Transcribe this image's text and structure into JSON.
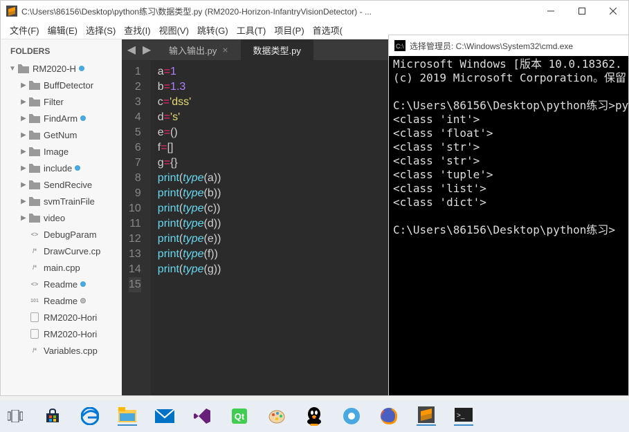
{
  "sublime": {
    "title": "C:\\Users\\86156\\Desktop\\python练习\\数据类型.py (RM2020-Horizon-InfantryVisionDetector) - ...",
    "menu": [
      "文件(F)",
      "编辑(E)",
      "选择(S)",
      "查找(I)",
      "视图(V)",
      "跳转(G)",
      "工具(T)",
      "项目(P)",
      "首选项("
    ],
    "sidebar_header": "FOLDERS",
    "tree": [
      {
        "depth": 0,
        "type": "folder-open",
        "name": "RM2020-H",
        "dot": "b",
        "arrow": "▼"
      },
      {
        "depth": 1,
        "type": "folder",
        "name": "BuffDetector",
        "arrow": "▶"
      },
      {
        "depth": 1,
        "type": "folder",
        "name": "Filter",
        "arrow": "▶"
      },
      {
        "depth": 1,
        "type": "folder",
        "name": "FindArm",
        "dot": "b",
        "arrow": "▶"
      },
      {
        "depth": 1,
        "type": "folder",
        "name": "GetNum",
        "arrow": "▶"
      },
      {
        "depth": 1,
        "type": "folder",
        "name": "Image",
        "arrow": "▶"
      },
      {
        "depth": 1,
        "type": "folder",
        "name": "include",
        "dot": "b",
        "arrow": "▶"
      },
      {
        "depth": 1,
        "type": "folder",
        "name": "SendRecive",
        "arrow": "▶"
      },
      {
        "depth": 1,
        "type": "folder",
        "name": "svmTrainFile",
        "arrow": "▶"
      },
      {
        "depth": 1,
        "type": "folder",
        "name": "video",
        "arrow": "▶"
      },
      {
        "depth": 1,
        "type": "code",
        "name": "DebugParam",
        "arrow": ""
      },
      {
        "depth": 1,
        "type": "cpp",
        "name": "DrawCurve.cp",
        "arrow": ""
      },
      {
        "depth": 1,
        "type": "cpp",
        "name": "main.cpp",
        "arrow": ""
      },
      {
        "depth": 1,
        "type": "code",
        "name": "Readme",
        "dot": "b",
        "arrow": ""
      },
      {
        "depth": 1,
        "type": "md",
        "name": "Readme",
        "dot": "g",
        "arrow": ""
      },
      {
        "depth": 1,
        "type": "file",
        "name": "RM2020-Hori",
        "arrow": ""
      },
      {
        "depth": 1,
        "type": "file",
        "name": "RM2020-Hori",
        "arrow": ""
      },
      {
        "depth": 1,
        "type": "cpp",
        "name": "Variables.cpp",
        "arrow": ""
      }
    ],
    "tabs": {
      "inactive": "输入输出.py",
      "active": "数据类型.py"
    },
    "code": [
      [
        [
          "var",
          "a"
        ],
        [
          "op",
          "="
        ],
        [
          "num",
          "1"
        ]
      ],
      [
        [
          "var",
          "b"
        ],
        [
          "op",
          "="
        ],
        [
          "num",
          "1.3"
        ]
      ],
      [
        [
          "var",
          "c"
        ],
        [
          "op",
          "="
        ],
        [
          "str",
          "'dss'"
        ]
      ],
      [
        [
          "var",
          "d"
        ],
        [
          "op",
          "="
        ],
        [
          "str",
          "'s'"
        ]
      ],
      [
        [
          "var",
          "e"
        ],
        [
          "op",
          "="
        ],
        [
          "pn",
          "()"
        ]
      ],
      [
        [
          "var",
          "f"
        ],
        [
          "op",
          "="
        ],
        [
          "pn",
          "[]"
        ]
      ],
      [
        [
          "var",
          "g"
        ],
        [
          "op",
          "="
        ],
        [
          "pn",
          "{}"
        ]
      ],
      [
        [
          "fn",
          "print"
        ],
        [
          "pn",
          "("
        ],
        [
          "bi",
          "type"
        ],
        [
          "pn",
          "("
        ],
        [
          "var",
          "a"
        ],
        [
          "pn",
          "))"
        ]
      ],
      [
        [
          "fn",
          "print"
        ],
        [
          "pn",
          "("
        ],
        [
          "bi",
          "type"
        ],
        [
          "pn",
          "("
        ],
        [
          "var",
          "b"
        ],
        [
          "pn",
          "))"
        ]
      ],
      [
        [
          "fn",
          "print"
        ],
        [
          "pn",
          "("
        ],
        [
          "bi",
          "type"
        ],
        [
          "pn",
          "("
        ],
        [
          "var",
          "c"
        ],
        [
          "pn",
          "))"
        ]
      ],
      [
        [
          "fn",
          "print"
        ],
        [
          "pn",
          "("
        ],
        [
          "bi",
          "type"
        ],
        [
          "pn",
          "("
        ],
        [
          "var",
          "d"
        ],
        [
          "pn",
          "))"
        ]
      ],
      [
        [
          "fn",
          "print"
        ],
        [
          "pn",
          "("
        ],
        [
          "bi",
          "type"
        ],
        [
          "pn",
          "("
        ],
        [
          "var",
          "e"
        ],
        [
          "pn",
          "))"
        ]
      ],
      [
        [
          "fn",
          "print"
        ],
        [
          "pn",
          "("
        ],
        [
          "bi",
          "type"
        ],
        [
          "pn",
          "("
        ],
        [
          "var",
          "f"
        ],
        [
          "pn",
          "))"
        ]
      ],
      [
        [
          "fn",
          "print"
        ],
        [
          "pn",
          "("
        ],
        [
          "bi",
          "type"
        ],
        [
          "pn",
          "("
        ],
        [
          "var",
          "g"
        ],
        [
          "pn",
          "))"
        ]
      ],
      []
    ],
    "cursor_line": 15
  },
  "cmd": {
    "title": "选择管理员: C:\\Windows\\System32\\cmd.exe",
    "lines": [
      "Microsoft Windows [版本 10.0.18362.",
      "(c) 2019 Microsoft Corporation。保留",
      "",
      "C:\\Users\\86156\\Desktop\\python练习>py",
      "<class 'int'>",
      "<class 'float'>",
      "<class 'str'>",
      "<class 'str'>",
      "<class 'tuple'>",
      "<class 'list'>",
      "<class 'dict'>",
      "",
      "C:\\Users\\86156\\Desktop\\python练习>"
    ]
  },
  "taskbar": [
    "task-view",
    "store",
    "edge",
    "explorer",
    "mail",
    "vstudio",
    "qt",
    "paint",
    "qq",
    "browser",
    "firefox",
    "sublime",
    "cmd"
  ]
}
